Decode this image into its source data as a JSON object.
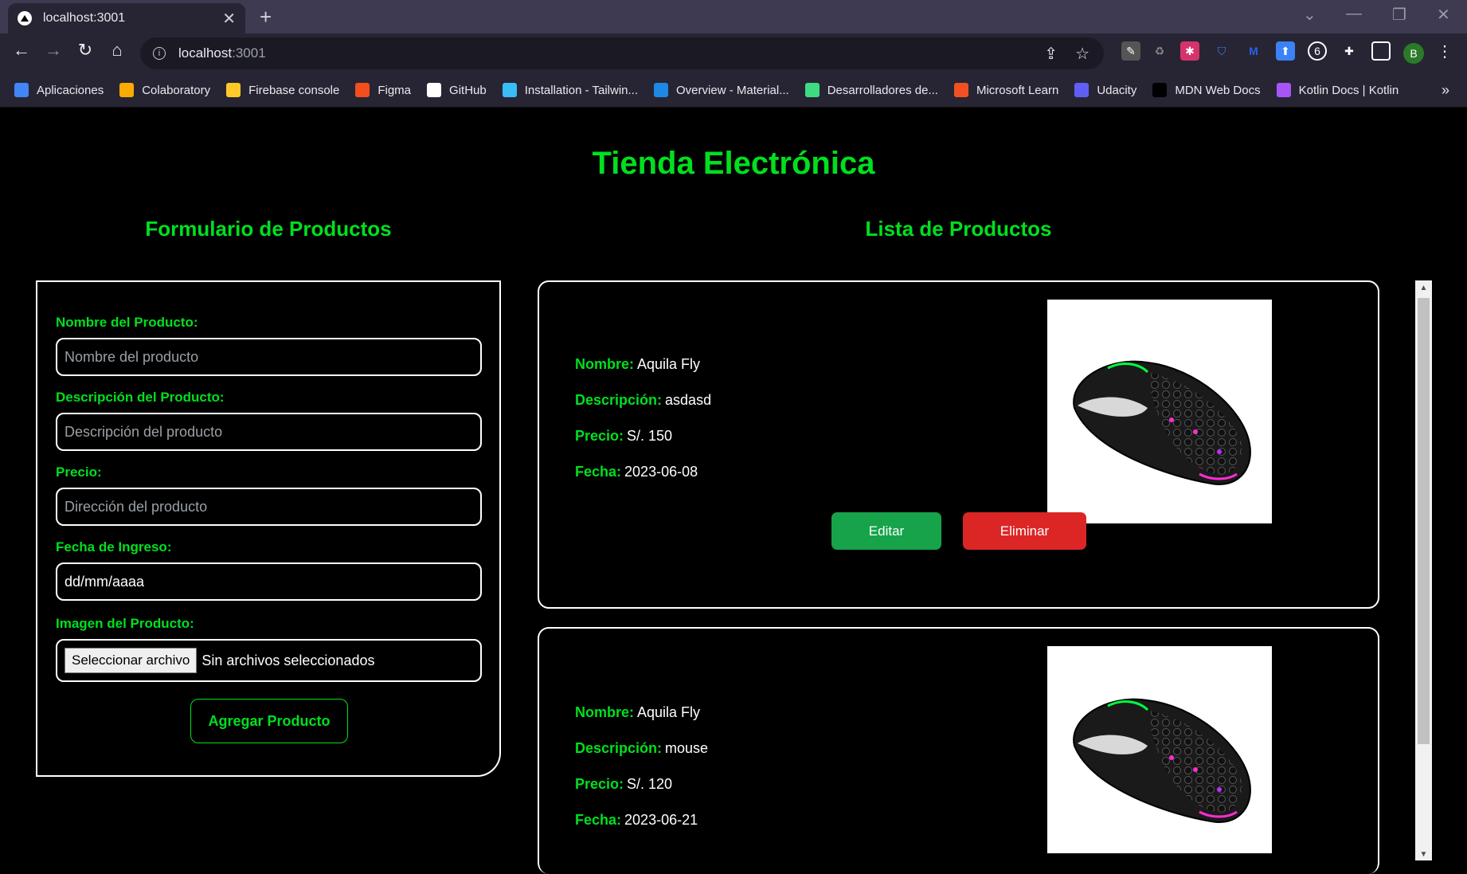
{
  "browser": {
    "tab_title": "localhost:3001",
    "url_host": "localhost",
    "url_port": ":3001",
    "profile_initial": "B",
    "bookmarks": [
      {
        "label": "Aplicaciones",
        "icon": "apps-grid-icon",
        "color": "#4285f4"
      },
      {
        "label": "Colaboratory",
        "icon": "colab-icon",
        "color": "#f9ab00"
      },
      {
        "label": "Firebase console",
        "icon": "firebase-icon",
        "color": "#ffca28"
      },
      {
        "label": "Figma",
        "icon": "figma-icon",
        "color": "#f24e1e"
      },
      {
        "label": "GitHub",
        "icon": "github-icon",
        "color": "#ffffff"
      },
      {
        "label": "Installation - Tailwin...",
        "icon": "tailwind-icon",
        "color": "#38bdf8"
      },
      {
        "label": "Overview - Material...",
        "icon": "material-icon",
        "color": "#1e88e5"
      },
      {
        "label": "Desarrolladores de...",
        "icon": "android-icon",
        "color": "#3ddc84"
      },
      {
        "label": "Microsoft Learn",
        "icon": "microsoft-icon",
        "color": "#f25022"
      },
      {
        "label": "Udacity",
        "icon": "udacity-icon",
        "color": "#5f5ff4"
      },
      {
        "label": "MDN Web Docs",
        "icon": "mdn-icon",
        "color": "#000000"
      },
      {
        "label": "Kotlin Docs | Kotlin",
        "icon": "kotlin-icon",
        "color": "#a855f7"
      }
    ]
  },
  "page": {
    "title": "Tienda Electrónica",
    "form_title": "Formulario de Productos",
    "list_title": "Lista de Productos"
  },
  "form": {
    "name_label": "Nombre del Producto:",
    "name_placeholder": "Nombre del producto",
    "desc_label": "Descripción del Producto:",
    "desc_placeholder": "Descripción del producto",
    "price_label": "Precio:",
    "price_placeholder": "Dirección del producto",
    "date_label": "Fecha de Ingreso:",
    "date_value": "dd/mm/aaaa",
    "image_label": "Imagen del Producto:",
    "file_button": "Seleccionar archivo",
    "file_status": "Sin archivos seleccionados",
    "submit_label": "Agregar Producto"
  },
  "labels": {
    "name": "Nombre:",
    "desc": "Descripción:",
    "price": "Precio:",
    "date": "Fecha:",
    "edit": "Editar",
    "delete": "Eliminar"
  },
  "products": [
    {
      "name": "Aquila Fly",
      "description": "asdasd",
      "price": "S/. 150",
      "date": "2023-06-08"
    },
    {
      "name": "Aquila Fly",
      "description": "mouse",
      "price": "S/. 120",
      "date": "2023-06-21"
    }
  ],
  "colors": {
    "accent_green": "#00e01e",
    "edit_button": "#16a34a",
    "delete_button": "#dc2626"
  }
}
